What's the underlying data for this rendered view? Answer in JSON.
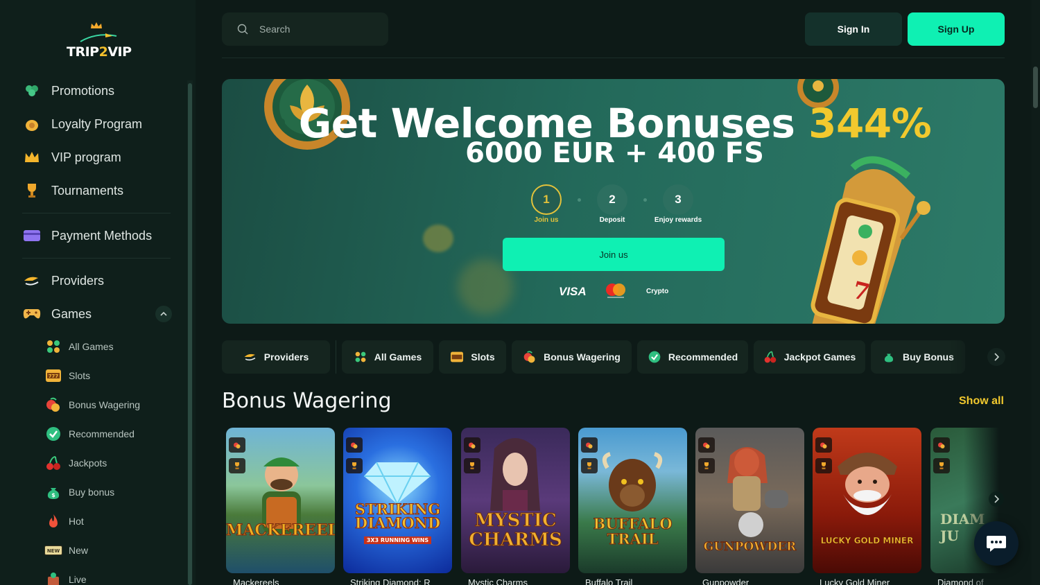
{
  "brand": {
    "logo_text_a": "TRIP",
    "logo_text_b": "2",
    "logo_text_c": "VIP"
  },
  "sidebar": {
    "main_items": [
      {
        "label": "Promotions",
        "icon": "clover-icon"
      },
      {
        "label": "Loyalty Program",
        "icon": "coin-bag-icon"
      },
      {
        "label": "VIP program",
        "icon": "crown-icon"
      },
      {
        "label": "Tournaments",
        "icon": "trophy-icon"
      },
      {
        "label": "Payment Methods",
        "icon": "card-icon"
      },
      {
        "label": "Providers",
        "icon": "providers-icon"
      },
      {
        "label": "Games",
        "icon": "gamepad-icon"
      }
    ],
    "game_items": [
      {
        "label": "All Games",
        "icon": "grid-icon"
      },
      {
        "label": "Slots",
        "icon": "slot-777-icon"
      },
      {
        "label": "Bonus Wagering",
        "icon": "bonus-icon"
      },
      {
        "label": "Recommended",
        "icon": "check-badge-icon"
      },
      {
        "label": "Jackpots",
        "icon": "cherry-icon"
      },
      {
        "label": "Buy bonus",
        "icon": "money-bag-icon"
      },
      {
        "label": "Hot",
        "icon": "flame-icon"
      },
      {
        "label": "New",
        "icon": "new-badge-icon"
      },
      {
        "label": "Live",
        "icon": "live-icon"
      }
    ]
  },
  "header": {
    "search_placeholder": "Search",
    "signin_label": "Sign In",
    "signup_label": "Sign Up"
  },
  "banner": {
    "title_main": "Get Welcome Bonuses ",
    "title_pct": "344%",
    "subtitle": "6000 EUR + 400 FS",
    "steps": [
      {
        "number": "1",
        "label": "Join us"
      },
      {
        "number": "2",
        "label": "Deposit"
      },
      {
        "number": "3",
        "label": "Enjoy rewards"
      }
    ],
    "cta_label": "Join us",
    "payments": {
      "visa": "VISA",
      "crypto": "Crypto"
    }
  },
  "categories": [
    {
      "label": "Providers",
      "icon": "providers-icon"
    },
    {
      "label": "All Games",
      "icon": "grid-icon"
    },
    {
      "label": "Slots",
      "icon": "slot-777-icon"
    },
    {
      "label": "Bonus Wagering",
      "icon": "bonus-icon"
    },
    {
      "label": "Recommended",
      "icon": "check-badge-icon"
    },
    {
      "label": "Jackpot Games",
      "icon": "cherry-icon"
    },
    {
      "label": "Buy Bonus",
      "icon": "money-bag-icon"
    }
  ],
  "section": {
    "title": "Bonus Wagering",
    "show_all": "Show all"
  },
  "games": [
    {
      "title": "Mackereels",
      "art_text": "MACKEREELS"
    },
    {
      "title": "Striking Diamond: R",
      "art_text": "STRIKING DIAMOND",
      "art_sub": "3X3 RUNNING WINS"
    },
    {
      "title": "Mystic Charms",
      "art_text": "MYSTIC CHARMS"
    },
    {
      "title": "Buffalo Trail",
      "art_text": "BUFFALO TRAIL"
    },
    {
      "title": "Gunpowder",
      "art_text": "GUNPOWDER"
    },
    {
      "title": "Lucky Gold Miner",
      "art_text": "LUCKY GOLD MINER"
    },
    {
      "title": "Diamond of",
      "art_text": "DIAM JU"
    }
  ],
  "colors": {
    "accent": "#0ff0b3",
    "gold": "#f2c92e",
    "bg": "#0d1a17",
    "panel": "#15251f"
  }
}
